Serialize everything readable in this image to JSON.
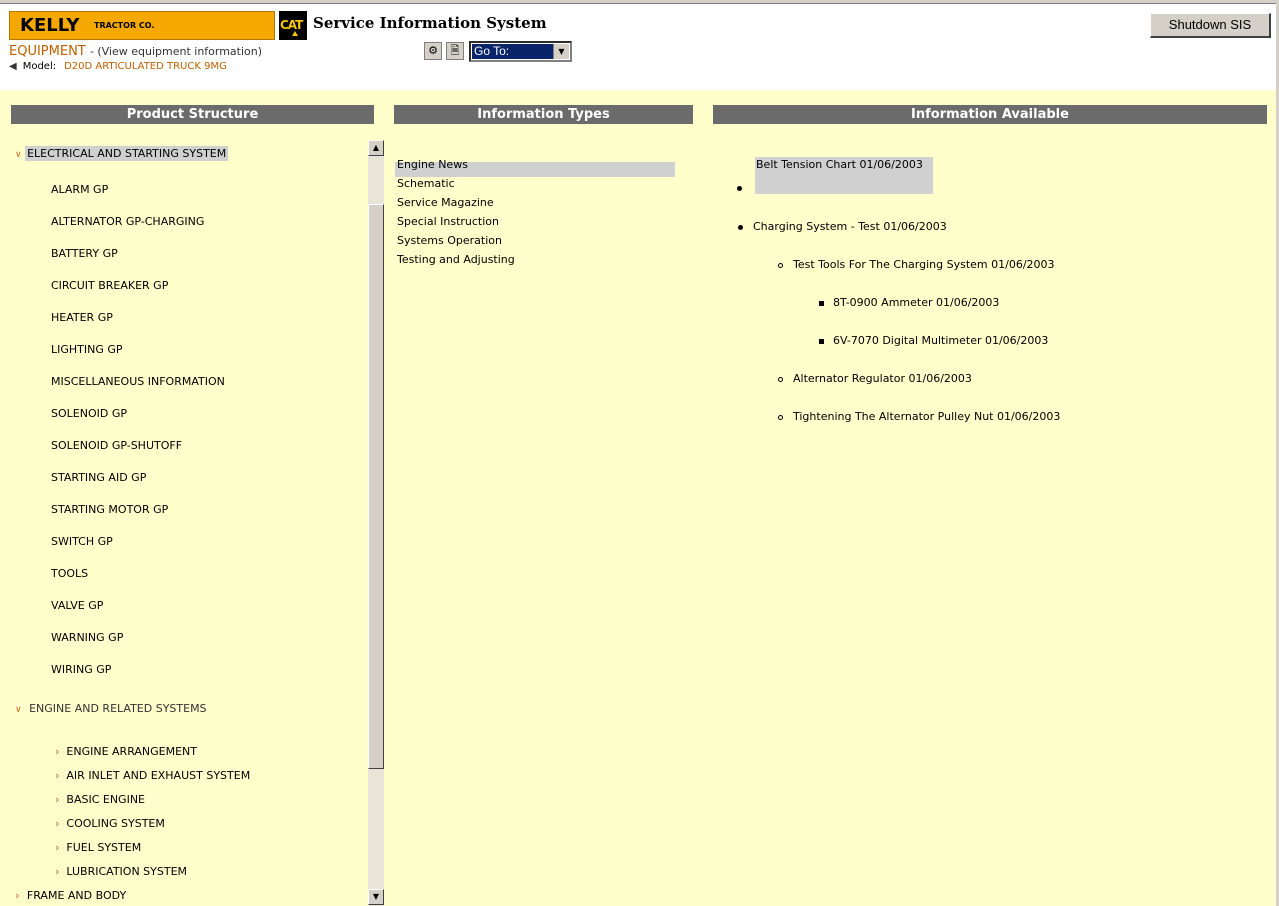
{
  "header": {
    "kelly_name": "KELLY",
    "kelly_sub": "TRACTOR CO.",
    "cat_logo": "CAT",
    "title": "Service Information System",
    "shutdown_label": "Shutdown SIS",
    "equipment_label": "EQUIPMENT",
    "equipment_sub": "- (View equipment information)",
    "model_label": "Model:",
    "model_value": "D20D ARTICULATED TRUCK 9MG",
    "goto_value": "Go To:",
    "icons": [
      "gear-icon",
      "document-icon"
    ]
  },
  "panels": {
    "product_structure": "Product Structure",
    "information_types": "Information Types",
    "information_available": "Information Available"
  },
  "product_structure": {
    "electrical": "ELECTRICAL AND STARTING SYSTEM",
    "electrical_items": [
      "ALARM GP",
      "ALTERNATOR GP-CHARGING",
      "BATTERY GP",
      "CIRCUIT BREAKER GP",
      "HEATER GP",
      "LIGHTING GP",
      "MISCELLANEOUS INFORMATION",
      "SOLENOID GP",
      "SOLENOID GP-SHUTOFF",
      "STARTING AID GP",
      "STARTING MOTOR GP",
      "SWITCH GP",
      "TOOLS",
      "VALVE GP",
      "WARNING GP",
      "WIRING GP"
    ],
    "engine": "ENGINE AND RELATED SYSTEMS",
    "engine_items": [
      "ENGINE ARRANGEMENT",
      "AIR INLET AND EXHAUST SYSTEM",
      "BASIC ENGINE",
      "COOLING SYSTEM",
      "FUEL SYSTEM",
      "LUBRICATION SYSTEM"
    ],
    "frame": "FRAME AND BODY"
  },
  "information_types": [
    "Engine News",
    "Schematic",
    "Service Magazine",
    "Special Instruction",
    "Systems Operation",
    "Testing and Adjusting"
  ],
  "information_available": {
    "belt": "Belt Tension Chart 01/06/2003",
    "charging": "Charging System - Test 01/06/2003",
    "test_tools": "Test Tools For The Charging System 01/06/2003",
    "ammeter": "8T-0900 Ammeter 01/06/2003",
    "multimeter": "6V-7070 Digital Multimeter 01/06/2003",
    "regulator": "Alternator Regulator 01/06/2003",
    "pulley": "Tightening The Alternator Pulley Nut 01/06/2003"
  }
}
